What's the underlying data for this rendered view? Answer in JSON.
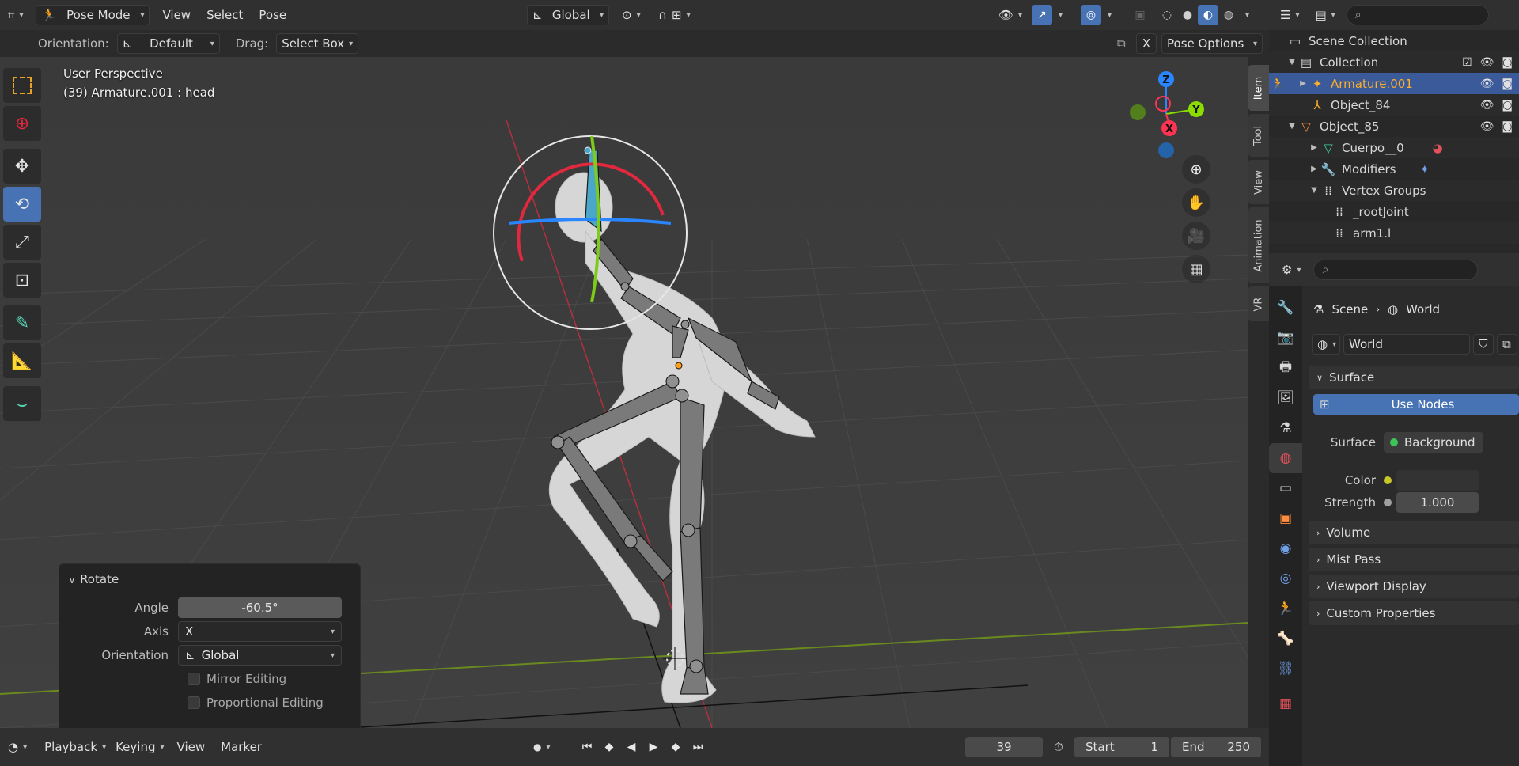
{
  "header": {
    "mode": "Pose Mode",
    "menus": [
      "View",
      "Select",
      "Pose"
    ],
    "transform_orientation": "Global"
  },
  "tool_header": {
    "orientation_label": "Orientation:",
    "orientation_value": "Default",
    "drag_label": "Drag:",
    "drag_value": "Select Box",
    "x_label": "X",
    "pose_options": "Pose Options"
  },
  "viewport": {
    "perspective": "User Perspective",
    "active": "(39) Armature.001 : head",
    "side_tabs": [
      "Item",
      "Tool",
      "View",
      "Animation",
      "VR"
    ],
    "gizmo": {
      "x": "X",
      "y": "Y",
      "z": "Z"
    }
  },
  "operator": {
    "title": "Rotate",
    "angle_label": "Angle",
    "angle_value": "-60.5°",
    "axis_label": "Axis",
    "axis_value": "X",
    "orientation_label": "Orientation",
    "orientation_value": "Global",
    "mirror": "Mirror Editing",
    "proportional": "Proportional Editing"
  },
  "timeline": {
    "menus": [
      "Playback",
      "Keying",
      "View",
      "Marker"
    ],
    "current_frame": "39",
    "start_label": "Start",
    "start_value": "1",
    "end_label": "End",
    "end_value": "250"
  },
  "outliner": {
    "rows": [
      {
        "label": "Scene Collection"
      },
      {
        "label": "Collection"
      },
      {
        "label": "Armature.001"
      },
      {
        "label": "Object_84"
      },
      {
        "label": "Object_85"
      },
      {
        "label": "Cuerpo__0"
      },
      {
        "label": "Modifiers"
      },
      {
        "label": "Vertex Groups"
      },
      {
        "label": "_rootJoint"
      },
      {
        "label": "arm1.l"
      }
    ]
  },
  "properties": {
    "crumb_scene": "Scene",
    "crumb_world": "World",
    "world_name": "World",
    "surface_panel": "Surface",
    "use_nodes": "Use Nodes",
    "surface_label": "Surface",
    "surface_value": "Background",
    "color_label": "Color",
    "strength_label": "Strength",
    "strength_value": "1.000",
    "panels": [
      "Volume",
      "Mist Pass",
      "Viewport Display",
      "Custom Properties"
    ]
  },
  "colors": {
    "accent": "#4772b3",
    "x_axis": "#ff3352",
    "y_axis": "#8bdc00",
    "z_axis": "#2890ff",
    "selected_object": "#ffaf29"
  }
}
